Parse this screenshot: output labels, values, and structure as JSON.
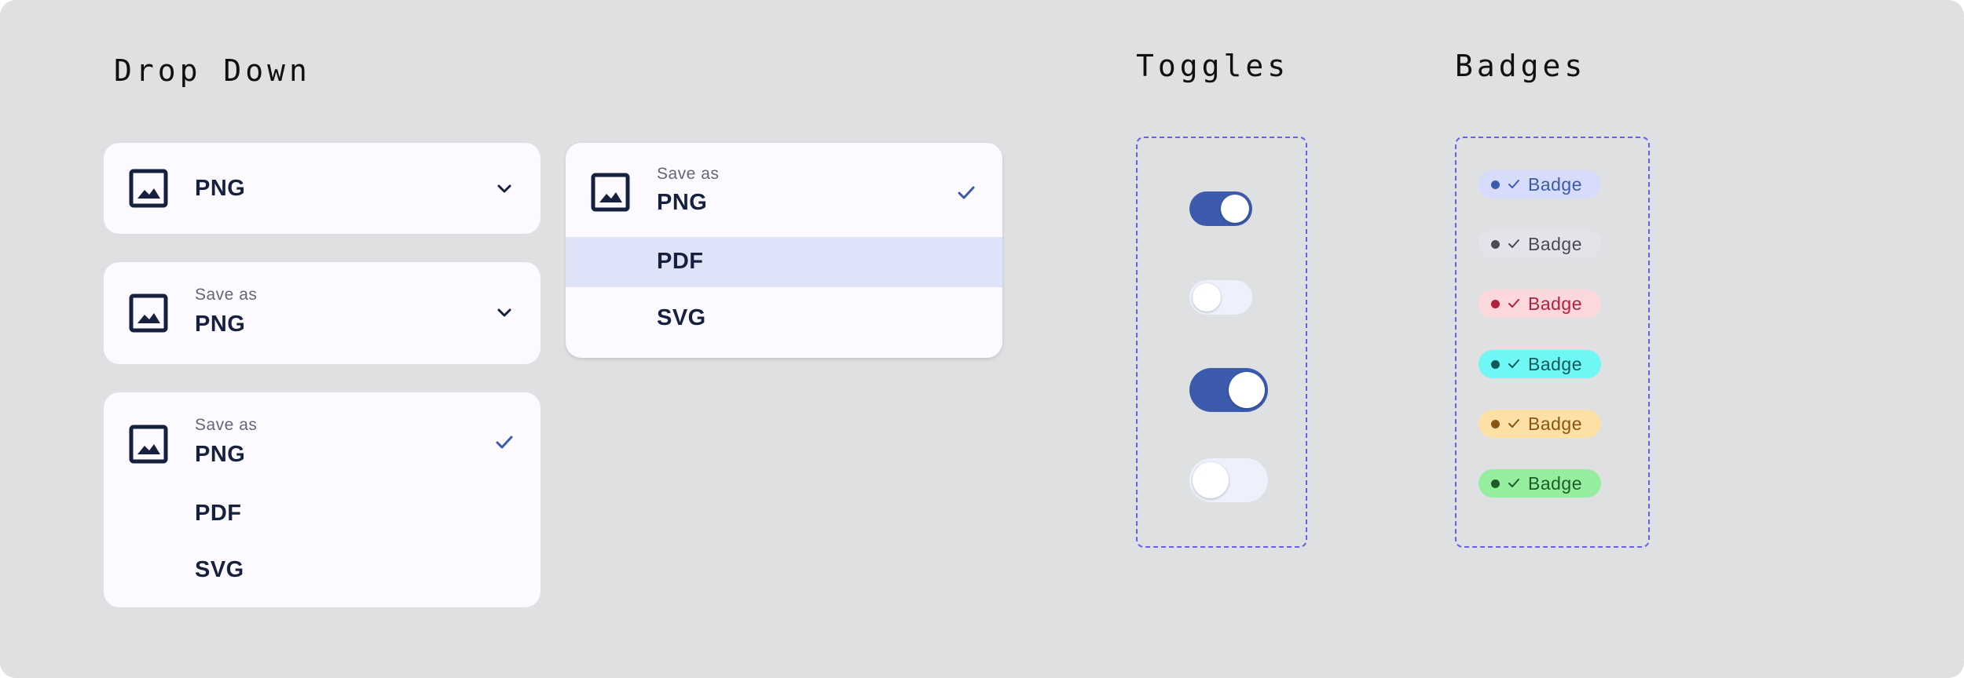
{
  "sections": {
    "dropdown_title": "Drop Down",
    "toggles_title": "Toggles",
    "badges_title": "Badges"
  },
  "dropdowns": {
    "simple": {
      "value": "PNG"
    },
    "labeled": {
      "label": "Save as",
      "value": "PNG"
    },
    "open": {
      "label": "Save as",
      "value": "PNG",
      "options": [
        "PDF",
        "SVG"
      ]
    },
    "open_highlight": {
      "label": "Save as",
      "value": "PNG",
      "options": [
        "PDF",
        "SVG"
      ],
      "highlighted": "PDF"
    }
  },
  "toggles": [
    {
      "size": "small",
      "on": true
    },
    {
      "size": "small",
      "on": false
    },
    {
      "size": "large",
      "on": true
    },
    {
      "size": "large",
      "on": false
    }
  ],
  "badges": [
    {
      "text": "Badge",
      "bg": "#d8dcfb",
      "fg": "#3b5ba9"
    },
    {
      "text": "Badge",
      "bg": "#e3e3ea",
      "fg": "#4a4a57"
    },
    {
      "text": "Badge",
      "bg": "#fcd7dc",
      "fg": "#b21f3b"
    },
    {
      "text": "Badge",
      "bg": "#6ef7f4",
      "fg": "#0d5a5b"
    },
    {
      "text": "Badge",
      "bg": "#fde0a6",
      "fg": "#8a5310"
    },
    {
      "text": "Badge",
      "bg": "#95ee9d",
      "fg": "#1b5c2a"
    }
  ],
  "colors": {
    "toggle_on": "#3c5bad",
    "toggle_off": "#eef1fc",
    "icon_navy": "#16213f",
    "accent_blue": "#3b5ba9",
    "dash_purple": "#6a5df0",
    "highlight": "#dee3f9"
  },
  "icons": {
    "image": "image-icon",
    "chevron": "chevron-down-icon",
    "check": "check-icon"
  }
}
